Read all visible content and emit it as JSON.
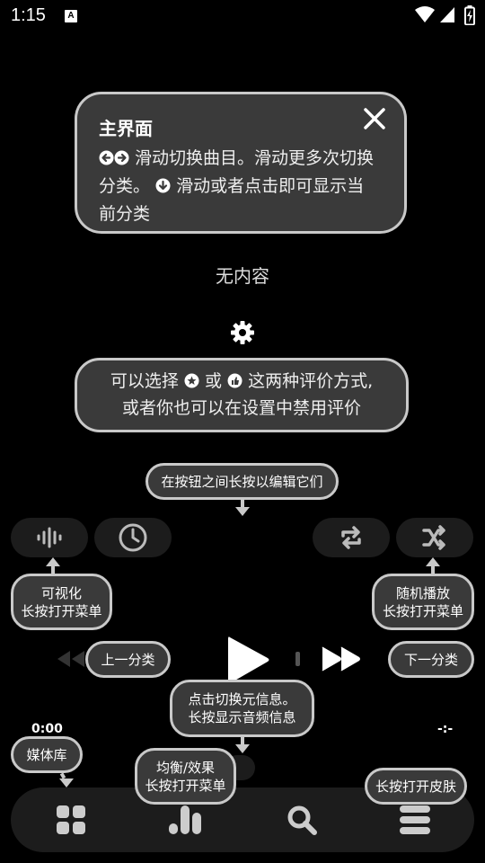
{
  "status_bar": {
    "time": "1:15",
    "notification_icon": "A"
  },
  "tip_main": {
    "title": "主界面",
    "line1": "滑动切换曲目。滑动更多次切换",
    "line2a": "分类。",
    "line2b": "滑动或者点击即可显示当",
    "line3": "前分类"
  },
  "empty_text": "无内容",
  "tip_rating": {
    "line1a": "可以选择",
    "line1b": "或",
    "line1c": "这两种评价方式,",
    "line2": "或者你也可以在设置中禁用评价"
  },
  "tip_edit_buttons": "在按钮之间长按以编辑它们",
  "tip_visualizer": {
    "line1": "可视化",
    "line2": "长按打开菜单"
  },
  "tip_shuffle": {
    "line1": "随机播放",
    "line2": "长按打开菜单"
  },
  "tip_prev_category": "上一分类",
  "tip_next_category": "下一分类",
  "tip_metadata": {
    "line1": "点击切换元信息。",
    "line2": "长按显示音频信息"
  },
  "elapsed_time": "0:00",
  "total_time": "-:-",
  "tip_library": "媒体库",
  "tip_equalizer": {
    "line1": "均衡/效果",
    "line2": "长按打开菜单"
  },
  "tip_skin": "长按打开皮肤"
}
